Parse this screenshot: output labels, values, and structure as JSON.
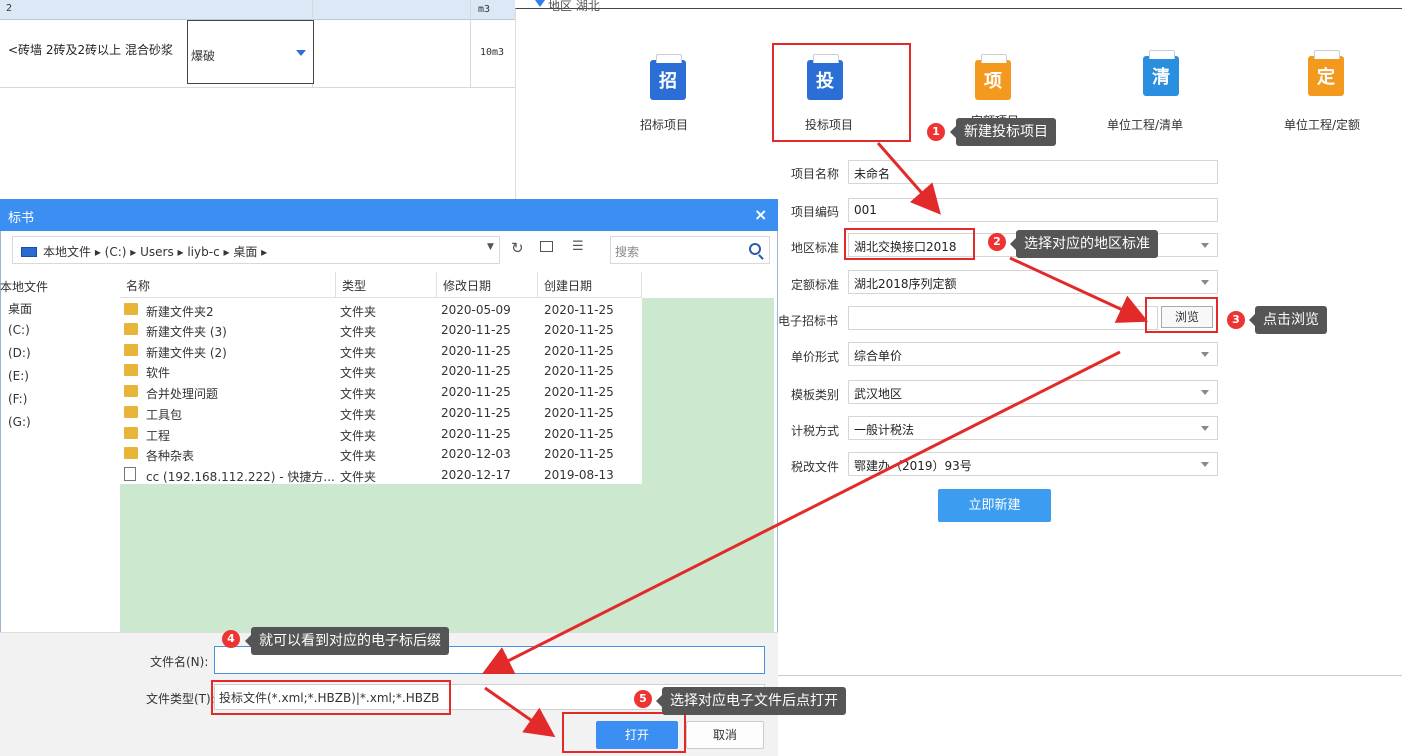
{
  "sheet": {
    "top_label": "2",
    "top_unit": "m3",
    "row_text": "<砖墙 2砖及2砖以上 混合砂浆",
    "combo_value": "爆破",
    "row_unit": "10m3"
  },
  "region": {
    "label": "地区 湖北"
  },
  "tiles": [
    {
      "label": "招标项目",
      "glyph": "招",
      "color": "#2b6fd6"
    },
    {
      "label": "投标项目",
      "glyph": "投",
      "color": "#2b6fd6"
    },
    {
      "label": "定额项目",
      "glyph": "项",
      "color": "#f39a1e"
    },
    {
      "label": "单位工程/清单",
      "glyph": "清",
      "color": "#2b8fe0"
    },
    {
      "label": "单位工程/定额",
      "glyph": "定",
      "color": "#f39a1e"
    }
  ],
  "form": {
    "project_name_label": "项目名称",
    "project_name": "未命名",
    "project_code_label": "项目编码",
    "project_code": "001",
    "region_std_label": "地区标准",
    "region_std": "湖北交换接口2018",
    "quota_std_label": "定额标准",
    "quota_std": "湖北2018序列定额",
    "e_tender_label": "电子招标书",
    "e_tender": "",
    "browse_label": "浏览",
    "price_form_label": "单价形式",
    "price_form": "综合单价",
    "template_label": "模板类别",
    "template": "武汉地区",
    "tax_method_label": "计税方式",
    "tax_method": "一般计税法",
    "tax_file_label": "税改文件",
    "tax_file": "鄂建办（2019）93号",
    "create_label": "立即新建"
  },
  "callouts": [
    {
      "num": "1",
      "text": "新建投标项目"
    },
    {
      "num": "2",
      "text": "选择对应的地区标准"
    },
    {
      "num": "3",
      "text": "点击浏览"
    },
    {
      "num": "4",
      "text": "就可以看到对应的电子标后缀"
    },
    {
      "num": "5",
      "text": "选择对应电子文件后点打开"
    }
  ],
  "dialog": {
    "title": "标书",
    "close": "×",
    "address": "本地文件 ▸ (C:) ▸ Users ▸ liyb-c ▸ 桌面 ▸",
    "search_placeholder": "搜索",
    "nav": [
      "本地文件",
      "桌面",
      "(C:)",
      "(D:)",
      "(E:)",
      "(F:)",
      "(G:)"
    ],
    "columns": [
      "名称",
      "类型",
      "修改日期",
      "创建日期"
    ],
    "files": [
      {
        "name": "新建文件夹2",
        "type": "文件夹",
        "modified": "2020-05-09",
        "created": "2020-11-25",
        "icon": "folder-icon"
      },
      {
        "name": "新建文件夹 (3)",
        "type": "文件夹",
        "modified": "2020-11-25",
        "created": "2020-11-25",
        "icon": "folder-icon"
      },
      {
        "name": "新建文件夹 (2)",
        "type": "文件夹",
        "modified": "2020-11-25",
        "created": "2020-11-25",
        "icon": "folder-icon"
      },
      {
        "name": "软件",
        "type": "文件夹",
        "modified": "2020-11-25",
        "created": "2020-11-25",
        "icon": "folder-icon"
      },
      {
        "name": "合并处理问题",
        "type": "文件夹",
        "modified": "2020-11-25",
        "created": "2020-11-25",
        "icon": "folder-icon"
      },
      {
        "name": "工具包",
        "type": "文件夹",
        "modified": "2020-11-25",
        "created": "2020-11-25",
        "icon": "folder-icon"
      },
      {
        "name": "工程",
        "type": "文件夹",
        "modified": "2020-11-25",
        "created": "2020-11-25",
        "icon": "folder-icon"
      },
      {
        "name": "各种杂表",
        "type": "文件夹",
        "modified": "2020-12-03",
        "created": "2020-11-25",
        "icon": "folder-icon"
      },
      {
        "name": "cc (192.168.112.222) - 快捷方...",
        "type": "文件夹",
        "modified": "2020-12-17",
        "created": "2019-08-13",
        "icon": "shortcut-icon"
      }
    ],
    "filename_label": "文件名(N):",
    "filename_value": "",
    "filetype_label": "文件类型(T):",
    "filetype_value": "投标文件(*.xml;*.HBZB)|*.xml;*.HBZB",
    "open_label": "打开",
    "cancel_label": "取消"
  }
}
